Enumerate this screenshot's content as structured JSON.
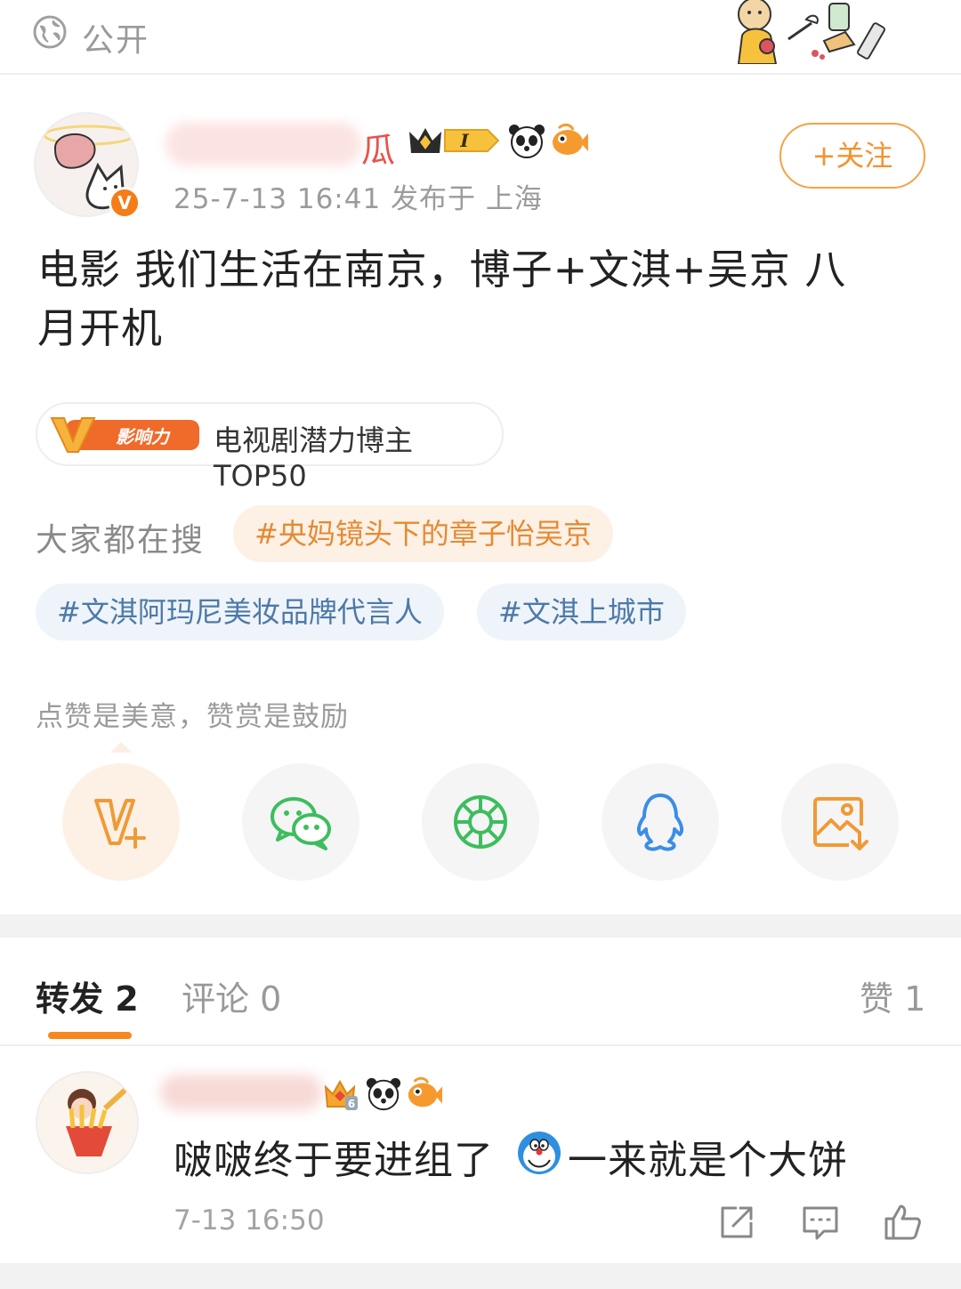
{
  "top_bar": {
    "visibility_label": "公开"
  },
  "post": {
    "author_name_tail": "瓜",
    "verified_mark": "V",
    "level_badge": "I",
    "meta": "25-7-13 16:41  发布于 上海",
    "follow_label": "+关注",
    "body_line1": "电影 我们生活在南京，博子+文淇+吴京 八",
    "body_line2": "月开机",
    "influence_badge_text": "影响力",
    "influence_label": "电视剧潜力博主TOP50"
  },
  "trending": {
    "label": "大家都在搜",
    "tags": [
      "#央妈镜头下的章子怡吴京",
      "#文淇阿玛尼美妆品牌代言人",
      "#文淇上城市"
    ]
  },
  "reward_hint": "点赞是美意，赞赏是鼓励",
  "share_buttons": [
    "reward-icon",
    "wechat-icon",
    "moments-icon",
    "qq-icon",
    "save-image-icon"
  ],
  "tabs": {
    "repost": "转发 2",
    "comment": "评论 0",
    "like": "赞 1"
  },
  "comment": {
    "text_part1": "啵啵终于要进组了",
    "text_part2": "一来就是个大饼",
    "time": "7-13 16:50",
    "badge_level": "6"
  },
  "colors": {
    "accent": "#f5891f",
    "follow": "#f5922f",
    "tag_orange_bg": "#fdf0e4",
    "tag_blue_text": "#4d79a8"
  }
}
